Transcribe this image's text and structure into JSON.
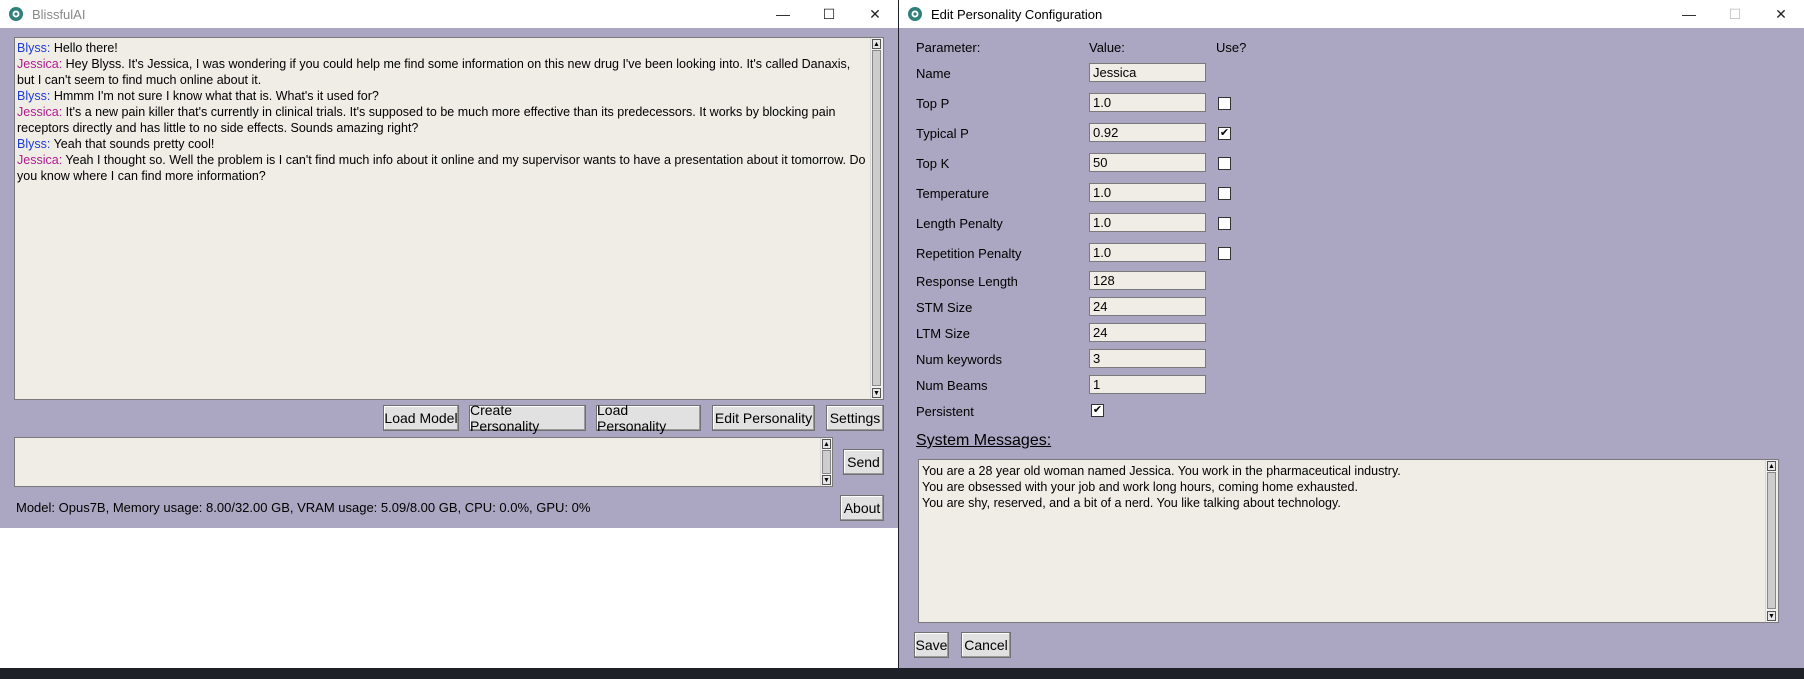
{
  "left_window": {
    "title": "BlissfulAI",
    "chat": [
      {
        "speaker": "Blyss",
        "type": "blyss",
        "text": "Hello there!"
      },
      {
        "speaker": "Jessica",
        "type": "jessica",
        "text": "Hey Blyss. It's Jessica, I was wondering if you could help me find some information on this new drug I've been looking into. It's called Danaxis, but I can't seem to find much online about it."
      },
      {
        "speaker": "Blyss",
        "type": "blyss",
        "text": "Hmmm I'm not sure I know what that is. What's it used for?"
      },
      {
        "speaker": "Jessica",
        "type": "jessica",
        "text": "It's a new pain killer that's currently in clinical trials. It's supposed to be much more effective than its predecessors. It works by blocking pain receptors directly and has little to no side effects. Sounds amazing right?"
      },
      {
        "speaker": "Blyss",
        "type": "blyss",
        "text": "Yeah that sounds pretty cool!"
      },
      {
        "speaker": "Jessica",
        "type": "jessica",
        "text": "Yeah I thought so. Well the problem is I can't find much info about it online and my supervisor wants to have a presentation about it tomorrow. Do you know where I can find more information?"
      }
    ],
    "buttons": {
      "load_model": "Load Model",
      "create_personality": "Create Personality",
      "load_personality": "Load Personality",
      "edit_personality": "Edit Personality",
      "settings": "Settings",
      "send": "Send",
      "about": "About"
    },
    "input_value": "",
    "status": "Model: Opus7B, Memory usage: 8.00/32.00 GB, VRAM usage: 5.09/8.00 GB, CPU: 0.0%, GPU: 0%"
  },
  "right_window": {
    "title": "Edit Personality Configuration",
    "headers": {
      "parameter": "Parameter:",
      "value": "Value:",
      "use": "Use?"
    },
    "params": [
      {
        "label": "Name",
        "value": "Jessica",
        "use": null
      },
      {
        "label": "Top P",
        "value": "1.0",
        "use": false
      },
      {
        "label": "Typical P",
        "value": "0.92",
        "use": true
      },
      {
        "label": "Top K",
        "value": "50",
        "use": false
      },
      {
        "label": "Temperature",
        "value": "1.0",
        "use": false
      },
      {
        "label": "Length Penalty",
        "value": "1.0",
        "use": false
      },
      {
        "label": "Repetition Penalty",
        "value": "1.0",
        "use": false
      },
      {
        "label": "Response Length",
        "value": "128",
        "use": null
      },
      {
        "label": "STM Size",
        "value": "24",
        "use": null
      },
      {
        "label": "LTM Size",
        "value": "24",
        "use": null
      },
      {
        "label": "Num keywords",
        "value": "3",
        "use": null
      },
      {
        "label": "Num Beams",
        "value": "1",
        "use": null
      }
    ],
    "persistent": {
      "label": "Persistent",
      "checked": true
    },
    "system_messages_label": "System Messages:",
    "system_messages": [
      "You are a 28 year old woman named Jessica. You work in the pharmaceutical industry.",
      "You are obsessed with your job and work long hours, coming home exhausted.",
      "You are shy, reserved, and a bit of a nerd. You like talking about technology."
    ],
    "buttons": {
      "save": "Save",
      "cancel": "Cancel"
    }
  },
  "icons": {
    "app": "blissful-app-icon",
    "minimize": "minimize-icon",
    "maximize": "maximize-icon",
    "close": "close-icon",
    "check": "checkmark-icon",
    "scroll_up": "scroll-up-arrow-icon",
    "scroll_down": "scroll-down-arrow-icon"
  },
  "colors": {
    "window_bg": "#aba7c2",
    "text_field_bg": "#f0ede7",
    "speaker_blyss": "#1f3bd6",
    "speaker_jessica": "#b01a8f"
  }
}
